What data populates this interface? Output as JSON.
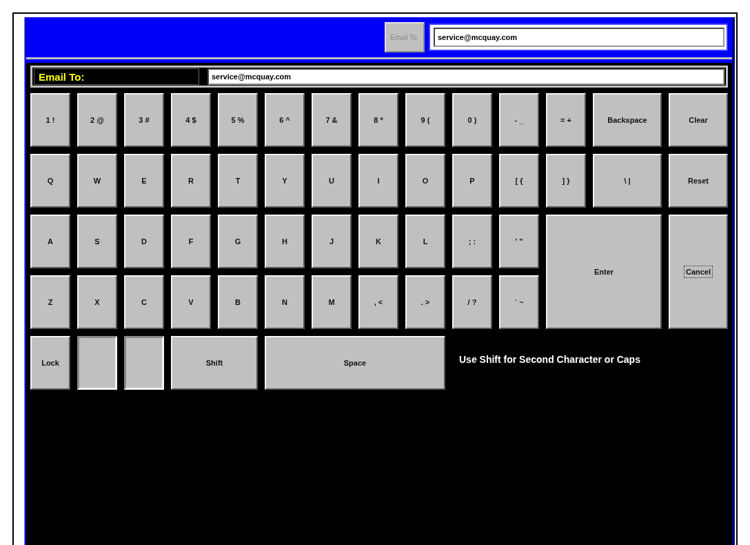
{
  "top_bar": {
    "button": {
      "label": "Email To:",
      "disabled": true
    },
    "field": {
      "value": "service@mcquay.com"
    }
  },
  "entry": {
    "label": "Email To:",
    "field": {
      "value": "service@mcquay.com"
    }
  },
  "keyboard": {
    "rows": [
      [
        {
          "label": "1 !",
          "kind": "key"
        },
        {
          "label": "2 @",
          "kind": "key"
        },
        {
          "label": "3 #",
          "kind": "key"
        },
        {
          "label": "4 $",
          "kind": "key"
        },
        {
          "label": "5 %",
          "kind": "key"
        },
        {
          "label": "6 ^",
          "kind": "key"
        },
        {
          "label": "7 &",
          "kind": "key"
        },
        {
          "label": "8 *",
          "kind": "key"
        },
        {
          "label": "9 (",
          "kind": "key"
        },
        {
          "label": "0 )",
          "kind": "key"
        },
        {
          "label": "- _",
          "kind": "key"
        },
        {
          "label": "= +",
          "kind": "key"
        },
        {
          "label": "Backspace",
          "kind": "key"
        },
        {
          "label": "Clear",
          "kind": "key"
        }
      ],
      [
        {
          "label": "Q",
          "kind": "key"
        },
        {
          "label": "W",
          "kind": "key"
        },
        {
          "label": "E",
          "kind": "key"
        },
        {
          "label": "R",
          "kind": "key"
        },
        {
          "label": "T",
          "kind": "key"
        },
        {
          "label": "Y",
          "kind": "key"
        },
        {
          "label": "U",
          "kind": "key"
        },
        {
          "label": "I",
          "kind": "key"
        },
        {
          "label": "O",
          "kind": "key"
        },
        {
          "label": "P",
          "kind": "key"
        },
        {
          "label": "[ {",
          "kind": "key"
        },
        {
          "label": "] }",
          "kind": "key"
        },
        {
          "label": "\\ |",
          "kind": "key"
        },
        {
          "label": "Reset",
          "kind": "key"
        }
      ],
      [
        {
          "label": "A",
          "kind": "key"
        },
        {
          "label": "S",
          "kind": "key"
        },
        {
          "label": "D",
          "kind": "key"
        },
        {
          "label": "F",
          "kind": "key"
        },
        {
          "label": "G",
          "kind": "key"
        },
        {
          "label": "H",
          "kind": "key"
        },
        {
          "label": "J",
          "kind": "key"
        },
        {
          "label": "K",
          "kind": "key"
        },
        {
          "label": "L",
          "kind": "key"
        },
        {
          "label": "; :",
          "kind": "key"
        },
        {
          "label": "' \"",
          "kind": "key"
        },
        {
          "label": "Enter",
          "kind": "big"
        },
        "",
        {
          "label": "Cancel",
          "kind": "tall",
          "focused": true
        }
      ],
      [
        {
          "label": "Z",
          "kind": "key"
        },
        {
          "label": "X",
          "kind": "key"
        },
        {
          "label": "C",
          "kind": "key"
        },
        {
          "label": "V",
          "kind": "key"
        },
        {
          "label": "B",
          "kind": "key"
        },
        {
          "label": "N",
          "kind": "key"
        },
        {
          "label": "M",
          "kind": "key"
        },
        {
          "label": ", <",
          "kind": "key"
        },
        {
          "label": ". >",
          "kind": "key"
        },
        {
          "label": "/ ?",
          "kind": "key"
        },
        {
          "label": "` ~",
          "kind": "key"
        }
      ],
      [
        {
          "label": "Lock",
          "kind": "key"
        },
        {
          "kind": "blank"
        },
        {
          "kind": "blank"
        },
        {
          "label": "Shift",
          "kind": "wide"
        },
        "",
        {
          "label": "Space",
          "kind": "space"
        }
      ]
    ],
    "hint": "Use Shift for Second Character or Caps"
  }
}
